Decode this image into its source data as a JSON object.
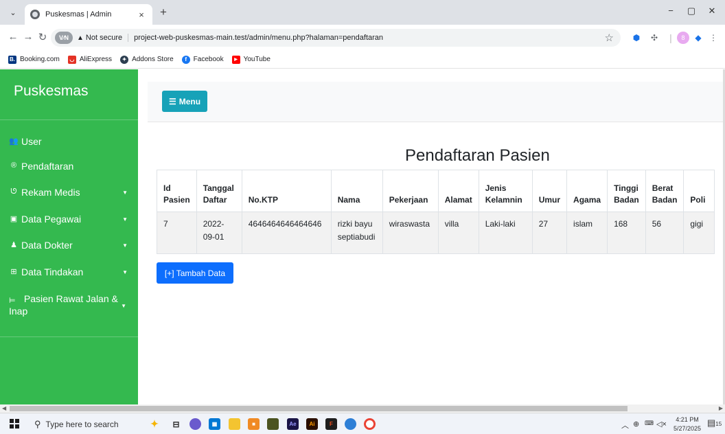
{
  "browser": {
    "tab_title": "Puskesmas | Admin",
    "tab_close": "×",
    "new_tab": "+",
    "window_controls": [
      "−",
      "▢",
      "✕"
    ],
    "vpn_badge": "V⁄N",
    "not_secure": "Not secure",
    "url": "project-web-puskesmas-main.test/admin/menu.php?halaman=pendaftaran",
    "bookmarks": [
      {
        "label": "Booking.com",
        "icon": "booking-icon",
        "icon_text": "B.",
        "color": "#003580"
      },
      {
        "label": "AliExpress",
        "icon": "aliexpress-icon",
        "icon_text": "",
        "color": "#e43225"
      },
      {
        "label": "Addons Store",
        "icon": "addons-store-icon",
        "icon_text": "",
        "color": "#1a73e8"
      },
      {
        "label": "Facebook",
        "icon": "facebook-icon",
        "icon_text": "f",
        "color": "#1877f2"
      },
      {
        "label": "YouTube",
        "icon": "youtube-icon",
        "icon_text": "▶",
        "color": "#ff0000"
      }
    ]
  },
  "sidebar": {
    "brand": "Puskesmas",
    "items": [
      {
        "label": "User",
        "icon": "users-icon",
        "has_caret": false
      },
      {
        "label": "Pendaftaran",
        "icon": "registered-icon",
        "has_caret": false
      },
      {
        "label": "Rekam Medis",
        "icon": "stethoscope-icon",
        "has_caret": true
      },
      {
        "label": "Data Pegawai",
        "icon": "id-card-icon",
        "has_caret": true
      },
      {
        "label": "Data Dokter",
        "icon": "doctor-icon",
        "has_caret": true
      },
      {
        "label": "Data Tindakan",
        "icon": "medkit-icon",
        "has_caret": true
      },
      {
        "label": "Pasien Rawat Jalan & Inap",
        "icon": "bed-icon",
        "has_caret": true
      }
    ],
    "bg_color": "#34b94f"
  },
  "main": {
    "menu_button": "Menu",
    "page_title": "Pendaftaran Pasien",
    "table": {
      "headers": [
        "Id Pasien",
        "Tanggal Daftar",
        "No.KTP",
        "Nama",
        "Pekerjaan",
        "Alamat",
        "Jenis Kelamnin",
        "Umur",
        "Agama",
        "Tinggi Badan",
        "Berat Badan",
        "Poli"
      ],
      "rows": [
        [
          "7",
          "2022-09-01",
          "4646464646464646",
          "rizki bayu septiabudi",
          "wiraswasta",
          "villa",
          "Laki-laki",
          "27",
          "islam",
          "168",
          "56",
          "gigi"
        ]
      ]
    },
    "add_button": "[+] Tambah Data"
  },
  "taskbar": {
    "search_placeholder": "Type here to search",
    "time": "4:21 PM",
    "date": "5/27/2025",
    "notification_count": "15"
  }
}
